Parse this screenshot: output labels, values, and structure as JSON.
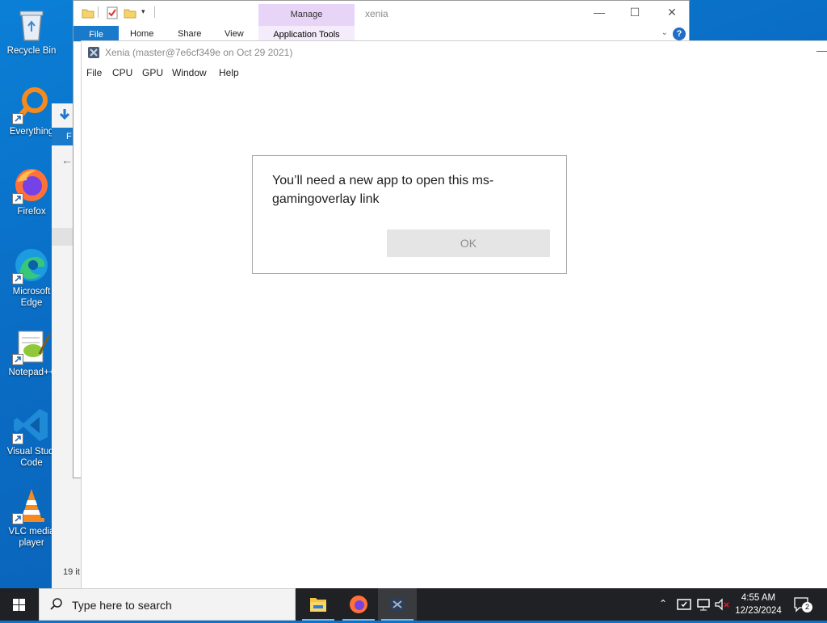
{
  "desktop": {
    "icons": [
      {
        "label": "Recycle Bin",
        "icon": "recycle-bin-icon"
      },
      {
        "label": "Everything",
        "icon": "everything-search-icon"
      },
      {
        "label": "Firefox",
        "icon": "firefox-icon"
      },
      {
        "label": "Microsoft Edge",
        "label_line1": "Microsoft",
        "label_line2": "Edge",
        "icon": "edge-icon"
      },
      {
        "label": "Notepad++",
        "icon": "notepad-plus-plus-icon"
      },
      {
        "label": "Visual Studio Code",
        "label_line1": "Visual Studi",
        "label_line2": "Code",
        "icon": "vscode-icon"
      },
      {
        "label": "VLC media player",
        "label_line1": "VLC media",
        "label_line2": "player",
        "icon": "vlc-icon"
      }
    ]
  },
  "explorer": {
    "title": "xenia",
    "manage_tab": "Manage",
    "ribbon_tabs": [
      "File",
      "Home",
      "Share",
      "View",
      "Application Tools"
    ],
    "back_win_tab": "F",
    "status": "19 it"
  },
  "xenia": {
    "title": "Xenia (master@7e6cf349e on Oct 29 2021)",
    "menu": [
      "File",
      "CPU",
      "GPU",
      "Window",
      "Help"
    ]
  },
  "dialog": {
    "message_line1": "You’ll need a new app to open this ms-",
    "message_line2": "gamingoverlay link",
    "ok_label": "OK"
  },
  "taskbar": {
    "search_placeholder": "Type here to search",
    "time": "4:55 AM",
    "date": "12/23/2024",
    "notification_count": "2",
    "apps": [
      "file-explorer-icon",
      "firefox-icon",
      "xenia-icon"
    ]
  },
  "colors": {
    "desktop_bg": "#0a6cc4",
    "taskbar_bg": "#202124",
    "ribbon_file_tab": "#1979ca",
    "manage_tab": "#e7d4f7"
  }
}
